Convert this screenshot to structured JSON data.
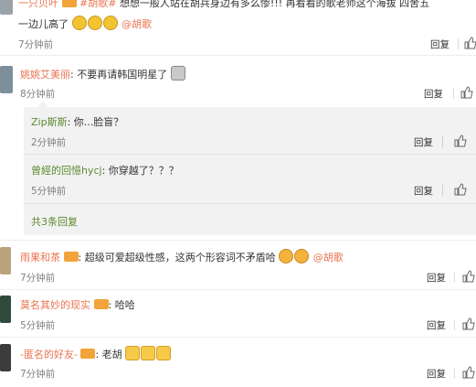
{
  "comments": [
    {
      "user": "一只贝叶",
      "text_top": "想想一般人站在胡兵身边有多么惨!!! 再看看的歌老师这个海拔 四舍五",
      "hashtag": "#胡歌#",
      "text_line2": "一边儿高了",
      "mention": "@胡歌",
      "time": "7分钟前",
      "reply": "回复"
    },
    {
      "user": "姚姚艾美丽",
      "text": ": 不要再请韩国明星了",
      "time": "8分钟前",
      "reply": "回复"
    }
  ],
  "nested": [
    {
      "user": "Zip斯斯",
      "text": ": 你...脸盲？",
      "time": "2分钟前",
      "reply": "回复"
    },
    {
      "user": "曾經的回憶hycj",
      "text": ": 你穿越了？？？",
      "time": "5分钟前",
      "reply": "回复"
    }
  ],
  "nested_more": "共3条回复",
  "bottom_comments": [
    {
      "user": "雨果和茶",
      "text": ": 超级可爱超级性感，这两个形容词不矛盾哈",
      "mention": "@胡歌",
      "time": "7分钟前",
      "reply": "回复"
    },
    {
      "user": "莫名其妙的现实",
      "text": ": 哈哈",
      "time": "5分钟前",
      "reply": "回复"
    },
    {
      "user": "-匿名的好友-",
      "text": ": 老胡",
      "time": "7分钟前",
      "reply": "回复"
    }
  ],
  "colors": {
    "username": "#eb7350",
    "link": "#5a8a2c",
    "nested_bg": "#f2f2f2"
  }
}
